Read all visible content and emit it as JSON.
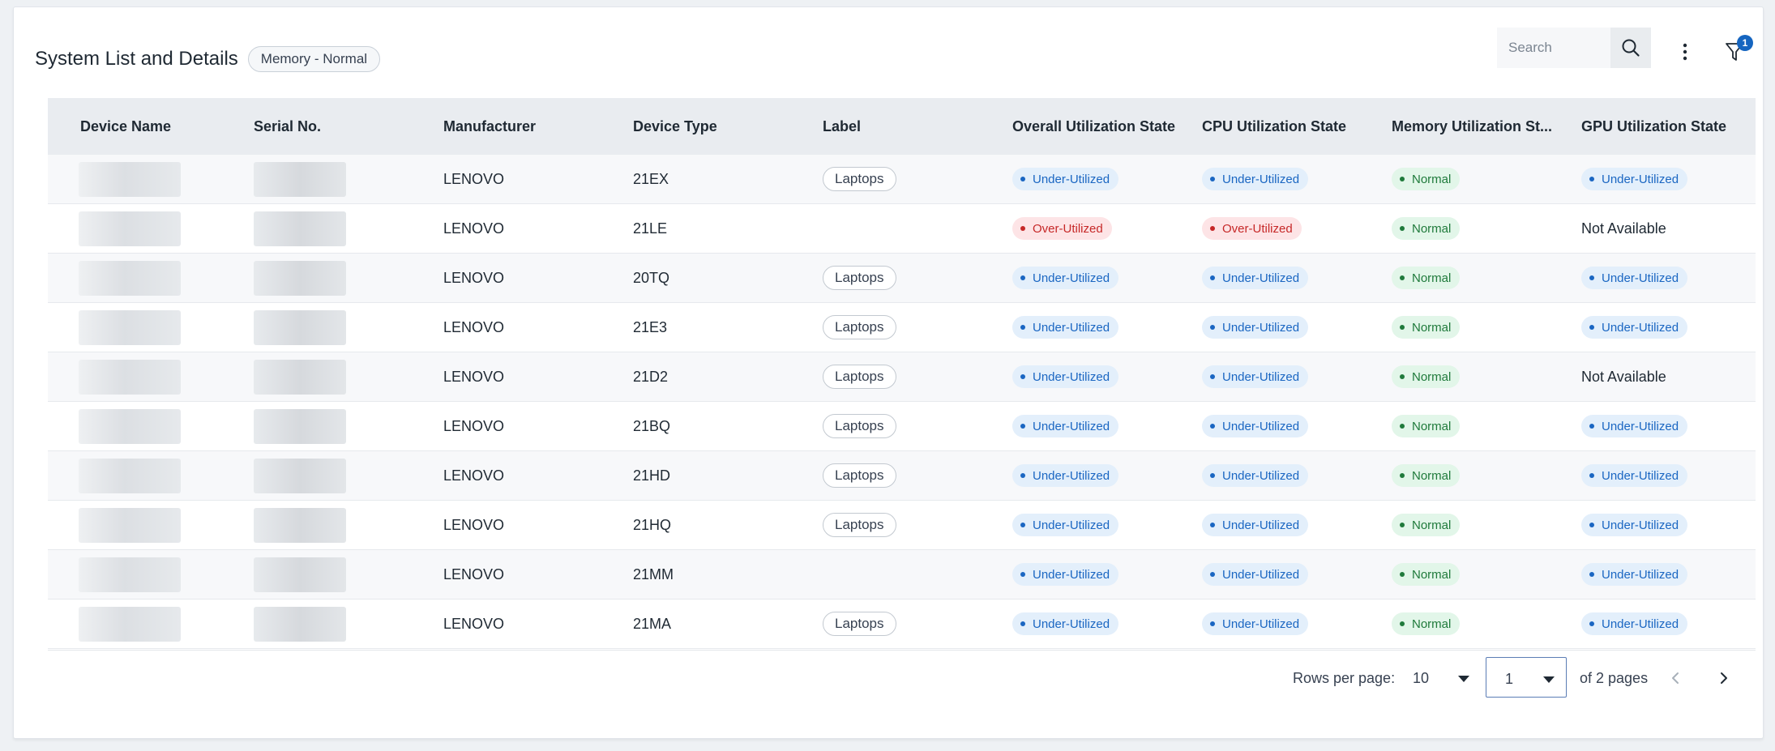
{
  "header": {
    "title": "System List and Details",
    "filter_chip": "Memory - Normal",
    "search_placeholder": "Search",
    "filter_badge_count": "1"
  },
  "columns": {
    "device_name": "Device Name",
    "serial_no": "Serial No.",
    "manufacturer": "Manufacturer",
    "device_type": "Device Type",
    "label": "Label",
    "overall": "Overall Utilization State",
    "cpu": "CPU Utilization State",
    "memory": "Memory Utilization St...",
    "gpu": "GPU Utilization State"
  },
  "rows": [
    {
      "manufacturer": "LENOVO",
      "device_type": "21EX",
      "label": "Laptops",
      "overall": "Under-Utilized",
      "cpu": "Under-Utilized",
      "memory": "Normal",
      "gpu": "Under-Utilized"
    },
    {
      "manufacturer": "LENOVO",
      "device_type": "21LE",
      "label": "",
      "overall": "Over-Utilized",
      "cpu": "Over-Utilized",
      "memory": "Normal",
      "gpu": "Not Available"
    },
    {
      "manufacturer": "LENOVO",
      "device_type": "20TQ",
      "label": "Laptops",
      "overall": "Under-Utilized",
      "cpu": "Under-Utilized",
      "memory": "Normal",
      "gpu": "Under-Utilized"
    },
    {
      "manufacturer": "LENOVO",
      "device_type": "21E3",
      "label": "Laptops",
      "overall": "Under-Utilized",
      "cpu": "Under-Utilized",
      "memory": "Normal",
      "gpu": "Under-Utilized"
    },
    {
      "manufacturer": "LENOVO",
      "device_type": "21D2",
      "label": "Laptops",
      "overall": "Under-Utilized",
      "cpu": "Under-Utilized",
      "memory": "Normal",
      "gpu": "Not Available"
    },
    {
      "manufacturer": "LENOVO",
      "device_type": "21BQ",
      "label": "Laptops",
      "overall": "Under-Utilized",
      "cpu": "Under-Utilized",
      "memory": "Normal",
      "gpu": "Under-Utilized"
    },
    {
      "manufacturer": "LENOVO",
      "device_type": "21HD",
      "label": "Laptops",
      "overall": "Under-Utilized",
      "cpu": "Under-Utilized",
      "memory": "Normal",
      "gpu": "Under-Utilized"
    },
    {
      "manufacturer": "LENOVO",
      "device_type": "21HQ",
      "label": "Laptops",
      "overall": "Under-Utilized",
      "cpu": "Under-Utilized",
      "memory": "Normal",
      "gpu": "Under-Utilized"
    },
    {
      "manufacturer": "LENOVO",
      "device_type": "21MM",
      "label": "",
      "overall": "Under-Utilized",
      "cpu": "Under-Utilized",
      "memory": "Normal",
      "gpu": "Under-Utilized"
    },
    {
      "manufacturer": "LENOVO",
      "device_type": "21MA",
      "label": "Laptops",
      "overall": "Under-Utilized",
      "cpu": "Under-Utilized",
      "memory": "Normal",
      "gpu": "Under-Utilized"
    }
  ],
  "pagination": {
    "rows_per_page_label": "Rows per page:",
    "rows_per_page_value": "10",
    "current_page": "1",
    "of_pages": "of 2 pages"
  },
  "colors": {
    "under_utilized": "#1a66c2",
    "over_utilized": "#c62828",
    "normal": "#1f7a3b",
    "badge": "#1565c0"
  },
  "icons": [
    "search-icon",
    "more-vertical-icon",
    "filter-icon",
    "caret-down-icon",
    "chevron-left-icon",
    "chevron-right-icon"
  ]
}
